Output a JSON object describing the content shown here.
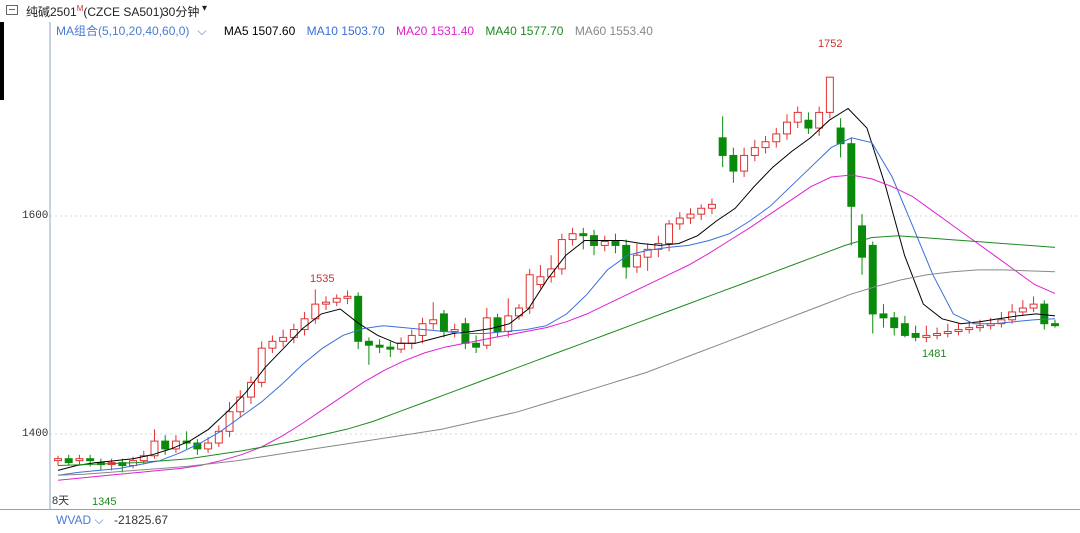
{
  "header": {
    "symbol": "纯碱2501",
    "symbol_mark": "M",
    "code": "(CZCE SA501)",
    "period": "30分钟",
    "chev": "▾"
  },
  "ma_legend": {
    "group": "MA组合(5,10,20,40,60,0)",
    "items": [
      {
        "label": "MA5 1507.60",
        "color": "#000000"
      },
      {
        "label": "MA10 1503.70",
        "color": "#3a6fd8"
      },
      {
        "label": "MA20 1531.40",
        "color": "#e020d0"
      },
      {
        "label": "MA40 1577.70",
        "color": "#1e8a1e"
      },
      {
        "label": "MA60 1553.40",
        "color": "#888888"
      }
    ]
  },
  "y_axis": {
    "labels": [
      "1600",
      "1400"
    ]
  },
  "annotations": {
    "high": "1752",
    "mid_high": "1535",
    "low_start": "1345",
    "low_end": "1481",
    "days": "8天"
  },
  "indicator": {
    "name": "WVAD",
    "value": "-21825.67"
  },
  "chart_data": {
    "type": "candlestick",
    "ylim": [
      1330,
      1790
    ],
    "grid": true,
    "series_colors": {
      "up": "#e03030",
      "down": "#0a8a0a"
    },
    "candles": [
      [
        1360,
        1362,
        1355,
        1365
      ],
      [
        1362,
        1358,
        1355,
        1366
      ],
      [
        1360,
        1362,
        1356,
        1366
      ],
      [
        1362,
        1360,
        1354,
        1366
      ],
      [
        1358,
        1356,
        1350,
        1362
      ],
      [
        1356,
        1358,
        1350,
        1362
      ],
      [
        1358,
        1355,
        1348,
        1362
      ],
      [
        1355,
        1360,
        1352,
        1364
      ],
      [
        1360,
        1365,
        1356,
        1370
      ],
      [
        1365,
        1380,
        1362,
        1392
      ],
      [
        1380,
        1372,
        1366,
        1386
      ],
      [
        1372,
        1380,
        1368,
        1386
      ],
      [
        1380,
        1378,
        1372,
        1390
      ],
      [
        1378,
        1372,
        1366,
        1382
      ],
      [
        1372,
        1378,
        1368,
        1384
      ],
      [
        1378,
        1390,
        1374,
        1396
      ],
      [
        1390,
        1410,
        1384,
        1420
      ],
      [
        1410,
        1425,
        1404,
        1432
      ],
      [
        1425,
        1440,
        1418,
        1446
      ],
      [
        1440,
        1475,
        1435,
        1482
      ],
      [
        1475,
        1482,
        1470,
        1488
      ],
      [
        1482,
        1486,
        1476,
        1494
      ],
      [
        1486,
        1494,
        1480,
        1500
      ],
      [
        1494,
        1505,
        1488,
        1512
      ],
      [
        1505,
        1520,
        1500,
        1535
      ],
      [
        1520,
        1522,
        1514,
        1528
      ],
      [
        1522,
        1526,
        1518,
        1530
      ],
      [
        1526,
        1528,
        1520,
        1534
      ],
      [
        1528,
        1482,
        1474,
        1532
      ],
      [
        1482,
        1478,
        1458,
        1486
      ],
      [
        1478,
        1476,
        1470,
        1484
      ],
      [
        1476,
        1474,
        1466,
        1482
      ],
      [
        1474,
        1480,
        1470,
        1486
      ],
      [
        1480,
        1488,
        1474,
        1494
      ],
      [
        1488,
        1500,
        1480,
        1506
      ],
      [
        1500,
        1504,
        1494,
        1522
      ],
      [
        1510,
        1492,
        1486,
        1514
      ],
      [
        1492,
        1494,
        1486,
        1500
      ],
      [
        1500,
        1480,
        1474,
        1506
      ],
      [
        1480,
        1476,
        1470,
        1488
      ],
      [
        1478,
        1506,
        1474,
        1516
      ],
      [
        1506,
        1492,
        1486,
        1510
      ],
      [
        1492,
        1508,
        1486,
        1526
      ],
      [
        1508,
        1516,
        1504,
        1520
      ],
      [
        1516,
        1550,
        1510,
        1556
      ],
      [
        1540,
        1548,
        1536,
        1560
      ],
      [
        1548,
        1556,
        1542,
        1570
      ],
      [
        1556,
        1586,
        1550,
        1592
      ],
      [
        1586,
        1592,
        1580,
        1598
      ],
      [
        1592,
        1590,
        1576,
        1598
      ],
      [
        1590,
        1580,
        1570,
        1596
      ],
      [
        1580,
        1584,
        1574,
        1590
      ],
      [
        1584,
        1580,
        1572,
        1592
      ],
      [
        1580,
        1558,
        1546,
        1586
      ],
      [
        1558,
        1570,
        1552,
        1582
      ],
      [
        1568,
        1576,
        1554,
        1582
      ],
      [
        1576,
        1582,
        1568,
        1590
      ],
      [
        1582,
        1602,
        1574,
        1606
      ],
      [
        1602,
        1608,
        1596,
        1614
      ],
      [
        1608,
        1612,
        1602,
        1618
      ],
      [
        1612,
        1618,
        1606,
        1622
      ],
      [
        1618,
        1622,
        1612,
        1628
      ],
      [
        1690,
        1672,
        1660,
        1712
      ],
      [
        1672,
        1656,
        1644,
        1680
      ],
      [
        1656,
        1672,
        1650,
        1680
      ],
      [
        1672,
        1680,
        1666,
        1688
      ],
      [
        1680,
        1686,
        1674,
        1692
      ],
      [
        1686,
        1694,
        1680,
        1700
      ],
      [
        1694,
        1706,
        1688,
        1714
      ],
      [
        1706,
        1716,
        1700,
        1722
      ],
      [
        1708,
        1700,
        1694,
        1716
      ],
      [
        1700,
        1716,
        1692,
        1722
      ],
      [
        1716,
        1752,
        1710,
        1752
      ],
      [
        1700,
        1684,
        1670,
        1710
      ],
      [
        1684,
        1620,
        1580,
        1690
      ],
      [
        1600,
        1568,
        1550,
        1612
      ],
      [
        1580,
        1510,
        1490,
        1584
      ],
      [
        1510,
        1506,
        1496,
        1520
      ],
      [
        1506,
        1496,
        1488,
        1512
      ],
      [
        1500,
        1488,
        1486,
        1508
      ],
      [
        1490,
        1486,
        1482,
        1498
      ],
      [
        1486,
        1488,
        1481,
        1498
      ],
      [
        1488,
        1490,
        1484,
        1496
      ],
      [
        1490,
        1492,
        1486,
        1500
      ],
      [
        1492,
        1494,
        1488,
        1500
      ],
      [
        1494,
        1496,
        1490,
        1502
      ],
      [
        1496,
        1498,
        1492,
        1504
      ],
      [
        1498,
        1500,
        1494,
        1506
      ],
      [
        1500,
        1504,
        1496,
        1512
      ],
      [
        1504,
        1512,
        1500,
        1520
      ],
      [
        1512,
        1516,
        1508,
        1524
      ],
      [
        1516,
        1520,
        1512,
        1528
      ],
      [
        1520,
        1500,
        1494,
        1524
      ],
      [
        1500,
        1498,
        1496,
        1504
      ]
    ],
    "ma_series": {
      "MA5": [
        1350,
        1355,
        1358,
        1360,
        1362,
        1366,
        1372,
        1380,
        1392,
        1410,
        1430,
        1455,
        1475,
        1495,
        1510,
        1515,
        1500,
        1488,
        1480,
        1480,
        1485,
        1490,
        1492,
        1495,
        1500,
        1515,
        1545,
        1570,
        1585,
        1585,
        1585,
        1582,
        1580,
        1582,
        1590,
        1605,
        1618,
        1640,
        1660,
        1676,
        1690,
        1708,
        1720,
        1700,
        1640,
        1570,
        1520,
        1505,
        1500,
        1502,
        1505,
        1508,
        1510,
        1508
      ],
      "MA10": [
        1345,
        1348,
        1350,
        1352,
        1356,
        1360,
        1368,
        1378,
        1390,
        1405,
        1420,
        1438,
        1458,
        1475,
        1488,
        1495,
        1498,
        1496,
        1494,
        1492,
        1490,
        1490,
        1492,
        1494,
        1498,
        1510,
        1530,
        1555,
        1570,
        1575,
        1578,
        1580,
        1585,
        1592,
        1605,
        1620,
        1640,
        1660,
        1680,
        1690,
        1685,
        1650,
        1600,
        1550,
        1510,
        1500,
        1500,
        1502,
        1504,
        1505
      ],
      "MA20": [
        1340,
        1342,
        1344,
        1346,
        1348,
        1350,
        1352,
        1355,
        1360,
        1366,
        1374,
        1385,
        1398,
        1412,
        1426,
        1440,
        1452,
        1462,
        1470,
        1476,
        1480,
        1484,
        1488,
        1492,
        1496,
        1502,
        1510,
        1520,
        1530,
        1540,
        1550,
        1560,
        1572,
        1585,
        1598,
        1612,
        1626,
        1640,
        1650,
        1652,
        1648,
        1640,
        1630,
        1615,
        1600,
        1585,
        1570,
        1555,
        1540,
        1531
      ],
      "MA40": [
        1355,
        1356,
        1357,
        1358,
        1360,
        1362,
        1366,
        1370,
        1375,
        1380,
        1386,
        1392,
        1400,
        1410,
        1420,
        1430,
        1440,
        1450,
        1460,
        1470,
        1480,
        1490,
        1500,
        1510,
        1520,
        1530,
        1540,
        1550,
        1560,
        1570,
        1580,
        1588,
        1590,
        1588,
        1586,
        1584,
        1582,
        1580,
        1578
      ],
      "MA60": [
        1345,
        1346,
        1348,
        1350,
        1352,
        1354,
        1357,
        1360,
        1364,
        1368,
        1372,
        1376,
        1380,
        1384,
        1388,
        1392,
        1398,
        1404,
        1410,
        1418,
        1426,
        1434,
        1442,
        1450,
        1460,
        1470,
        1480,
        1490,
        1500,
        1510,
        1520,
        1530,
        1538,
        1545,
        1550,
        1553,
        1555,
        1555,
        1554,
        1553
      ]
    }
  }
}
